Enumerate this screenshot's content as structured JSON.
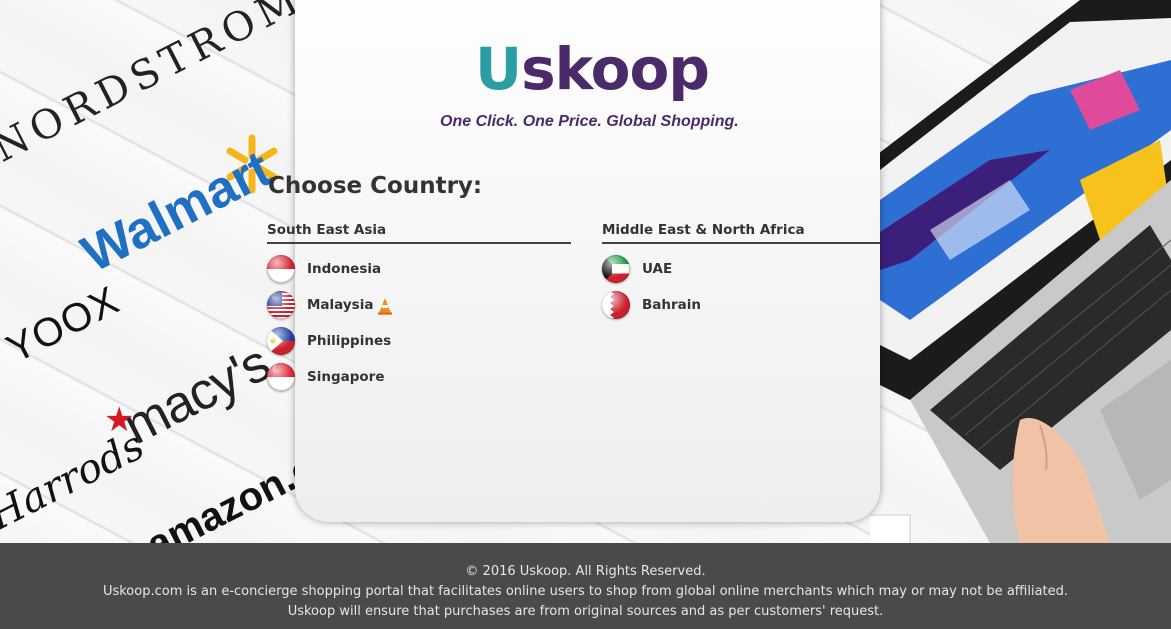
{
  "brand": {
    "logo_first": "U",
    "logo_rest": "skoop",
    "tagline": "One Click. One Price. Global Shopping."
  },
  "background_brands": {
    "nordstrom": "NORDSTROM",
    "walmart": "Walmart",
    "yoox": "YOOX",
    "macys": "macy's",
    "harrods": "Harrods",
    "amazon": "amazon.com"
  },
  "heading": "Choose Country:",
  "regions": [
    {
      "name": "South East Asia",
      "countries": [
        {
          "name": "Indonesia",
          "flag": "indonesia-flag"
        },
        {
          "name": "Malaysia",
          "flag": "malaysia-flag",
          "badge": "traffic-cone-icon"
        },
        {
          "name": "Philippines",
          "flag": "philippines-flag"
        },
        {
          "name": "Singapore",
          "flag": "singapore-flag"
        }
      ]
    },
    {
      "name": "Middle East & North Africa",
      "countries": [
        {
          "name": "UAE",
          "flag": "kuwait-style-flag"
        },
        {
          "name": "Bahrain",
          "flag": "bahrain-flag"
        }
      ]
    }
  ],
  "footer": {
    "copyright": "© 2016 Uskoop. All Rights Reserved.",
    "line1": "Uskoop.com is an e-concierge shopping portal that facilitates online users to shop from global online merchants which may or may not be affiliated.",
    "line2": "Uskoop will ensure that purchases are from original sources and as per customers' request."
  },
  "colors": {
    "logo_teal": "#2a9ea5",
    "logo_purple": "#4a2a68",
    "footer_bg": "#4a4a4a",
    "walmart_blue": "#1f6fc3",
    "macys_red": "#d51a22"
  }
}
